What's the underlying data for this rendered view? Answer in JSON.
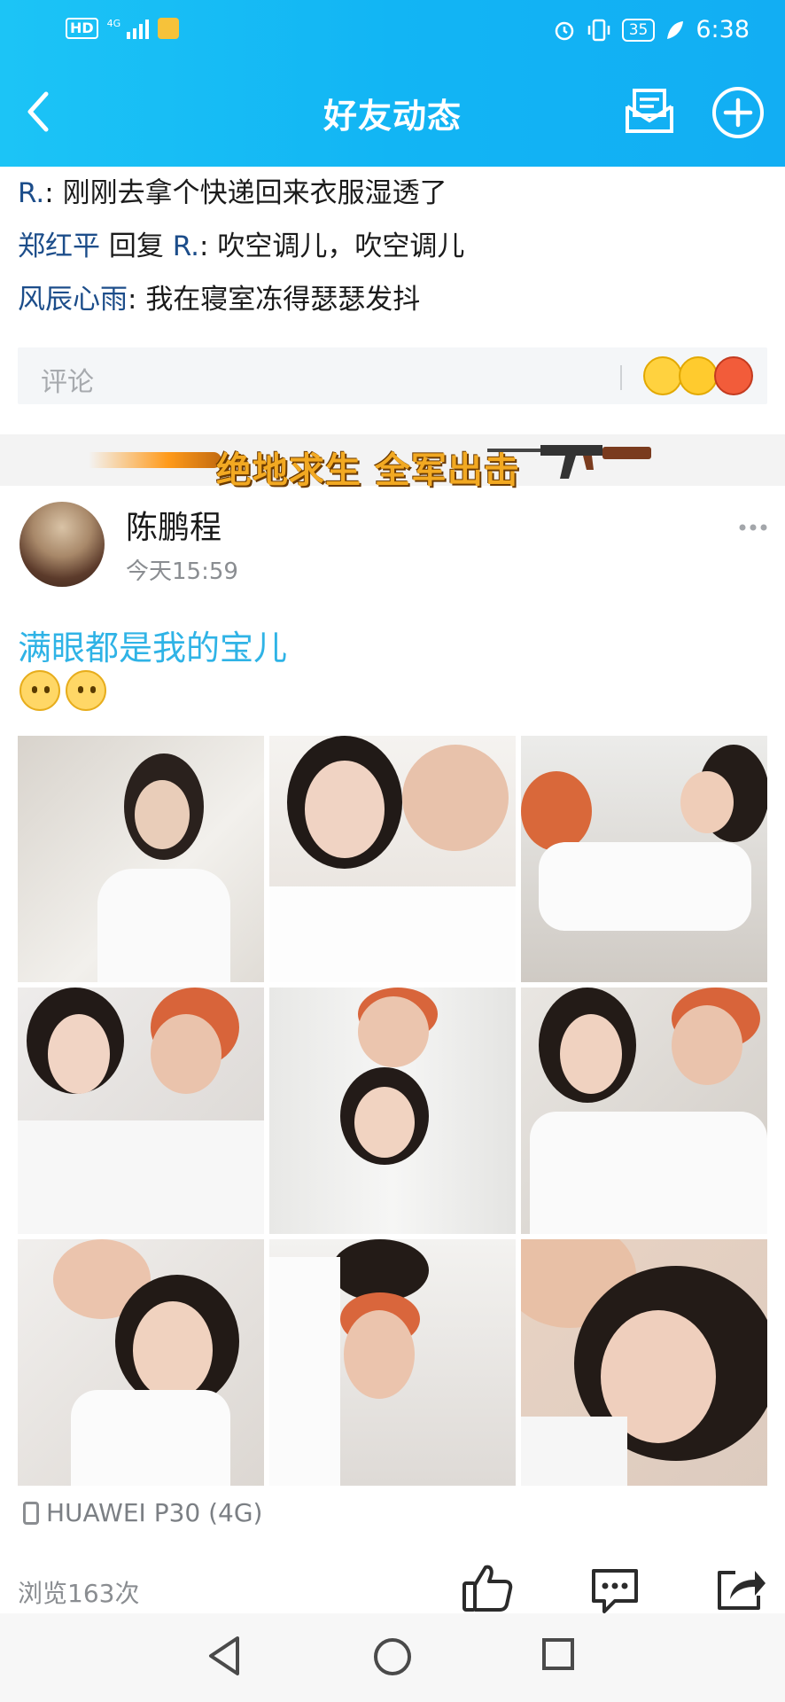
{
  "status_bar": {
    "hd": "HD",
    "network": "4G",
    "battery": "35",
    "time": "6:38"
  },
  "header": {
    "title": "好友动态"
  },
  "comments": [
    {
      "user": "R.",
      "reply_to": "",
      "text": "刚刚去拿个快递回来衣服湿透了"
    },
    {
      "user": "郑红平",
      "reply_label": "回复",
      "reply_to": "R.",
      "text": "吹空调儿，吹空调儿"
    },
    {
      "user": "风辰心雨",
      "reply_to": "",
      "text": "我在寝室冻得瑟瑟发抖"
    }
  ],
  "comment_input": {
    "placeholder": "评论"
  },
  "banner": {
    "text": "绝地求生 全军出击"
  },
  "post": {
    "author": "陈鹏程",
    "time": "今天15:59",
    "text": "满眼都是我的宝儿",
    "device": "HUAWEI P30 (4G)",
    "views": "浏览163次",
    "photos": 9
  },
  "colors": {
    "header": "#12b5f4",
    "username": "#1c4d8a",
    "post_text": "#2fb3e6"
  },
  "icons": {
    "back": "chevron-left-icon",
    "messages": "mail-icon",
    "add": "plus-circle-icon",
    "like": "thumbs-up-icon",
    "comment": "chat-bubble-icon",
    "share": "share-icon"
  }
}
